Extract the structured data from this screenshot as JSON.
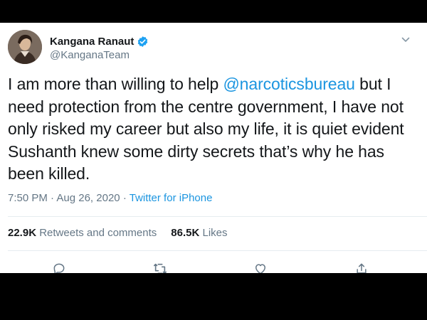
{
  "author": {
    "display_name": "Kangana Ranaut",
    "handle": "@KanganaTeam",
    "verified_icon": "verified-badge-icon",
    "avatar_icon": "avatar"
  },
  "tweet": {
    "text_before_mention": "I am more than willing to help ",
    "mention": "@narcoticsbureau",
    "text_after_mention": " but I need protection from the centre government, I have not only risked my career but also my life, it is quiet evident Sushanth knew some dirty secrets that’s why he has been killed.",
    "time": "7:50 PM",
    "date": "Aug 26, 2020",
    "separator": "·",
    "source": "Twitter for iPhone"
  },
  "stats": {
    "retweets_count": "22.9K",
    "retweets_label": "Retweets and comments",
    "likes_count": "86.5K",
    "likes_label": "Likes"
  },
  "actions": [
    "reply-icon",
    "retweet-icon",
    "like-icon",
    "share-icon"
  ],
  "colors": {
    "link": "#1b95e0",
    "text": "#14171a",
    "secondary": "#657786",
    "verified": "#1da1f2",
    "background_bars": "#000000"
  }
}
